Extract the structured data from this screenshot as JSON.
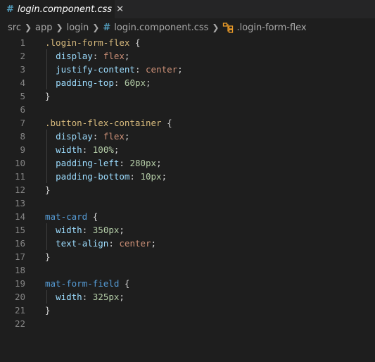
{
  "tab": {
    "icon": "#",
    "label": "login.component.css",
    "close": "✕"
  },
  "breadcrumb": {
    "items": [
      "src",
      "app",
      "login"
    ],
    "file_icon": "#",
    "file": "login.component.css",
    "symbol": ".login-form-flex"
  },
  "colors": {
    "background": "#1e1e1e",
    "selector": "#d7ba7d",
    "element_selector": "#569cd6",
    "property": "#9cdcfe",
    "string_value": "#ce9178",
    "number": "#b5cea8"
  },
  "lines": [
    {
      "n": "1",
      "tokens": [
        [
          "sel",
          ".login-form-flex"
        ],
        [
          "punc",
          " {"
        ]
      ]
    },
    {
      "n": "2",
      "tokens": [
        [
          "punc",
          "  "
        ],
        [
          "prop",
          "display"
        ],
        [
          "punc",
          ": "
        ],
        [
          "val",
          "flex"
        ],
        [
          "punc",
          ";"
        ]
      ]
    },
    {
      "n": "3",
      "tokens": [
        [
          "punc",
          "  "
        ],
        [
          "prop",
          "justify-content"
        ],
        [
          "punc",
          ": "
        ],
        [
          "val",
          "center"
        ],
        [
          "punc",
          ";"
        ]
      ]
    },
    {
      "n": "4",
      "tokens": [
        [
          "punc",
          "  "
        ],
        [
          "prop",
          "padding-top"
        ],
        [
          "punc",
          ": "
        ],
        [
          "num",
          "60px"
        ],
        [
          "punc",
          ";"
        ]
      ]
    },
    {
      "n": "5",
      "tokens": [
        [
          "punc",
          "}"
        ]
      ]
    },
    {
      "n": "6",
      "tokens": []
    },
    {
      "n": "7",
      "tokens": [
        [
          "sel",
          ".button-flex-container"
        ],
        [
          "punc",
          " {"
        ]
      ]
    },
    {
      "n": "8",
      "tokens": [
        [
          "punc",
          "  "
        ],
        [
          "prop",
          "display"
        ],
        [
          "punc",
          ": "
        ],
        [
          "val",
          "flex"
        ],
        [
          "punc",
          ";"
        ]
      ]
    },
    {
      "n": "9",
      "tokens": [
        [
          "punc",
          "  "
        ],
        [
          "prop",
          "width"
        ],
        [
          "punc",
          ": "
        ],
        [
          "num",
          "100%"
        ],
        [
          "punc",
          ";"
        ]
      ]
    },
    {
      "n": "10",
      "tokens": [
        [
          "punc",
          "  "
        ],
        [
          "prop",
          "padding-left"
        ],
        [
          "punc",
          ": "
        ],
        [
          "num",
          "280px"
        ],
        [
          "punc",
          ";"
        ]
      ]
    },
    {
      "n": "11",
      "tokens": [
        [
          "punc",
          "  "
        ],
        [
          "prop",
          "padding-bottom"
        ],
        [
          "punc",
          ": "
        ],
        [
          "num",
          "10px"
        ],
        [
          "punc",
          ";"
        ]
      ]
    },
    {
      "n": "12",
      "tokens": [
        [
          "punc",
          "}"
        ]
      ]
    },
    {
      "n": "13",
      "tokens": []
    },
    {
      "n": "14",
      "tokens": [
        [
          "tag",
          "mat-card"
        ],
        [
          "punc",
          " {"
        ]
      ]
    },
    {
      "n": "15",
      "tokens": [
        [
          "punc",
          "  "
        ],
        [
          "prop",
          "width"
        ],
        [
          "punc",
          ": "
        ],
        [
          "num",
          "350px"
        ],
        [
          "punc",
          ";"
        ]
      ]
    },
    {
      "n": "16",
      "tokens": [
        [
          "punc",
          "  "
        ],
        [
          "prop",
          "text-align"
        ],
        [
          "punc",
          ": "
        ],
        [
          "val",
          "center"
        ],
        [
          "punc",
          ";"
        ]
      ]
    },
    {
      "n": "17",
      "tokens": [
        [
          "punc",
          "}"
        ]
      ]
    },
    {
      "n": "18",
      "tokens": []
    },
    {
      "n": "19",
      "tokens": [
        [
          "tag",
          "mat-form-field"
        ],
        [
          "punc",
          " {"
        ]
      ]
    },
    {
      "n": "20",
      "tokens": [
        [
          "punc",
          "  "
        ],
        [
          "prop",
          "width"
        ],
        [
          "punc",
          ": "
        ],
        [
          "num",
          "325px"
        ],
        [
          "punc",
          ";"
        ]
      ]
    },
    {
      "n": "21",
      "tokens": [
        [
          "punc",
          "}"
        ]
      ]
    },
    {
      "n": "22",
      "tokens": []
    }
  ]
}
